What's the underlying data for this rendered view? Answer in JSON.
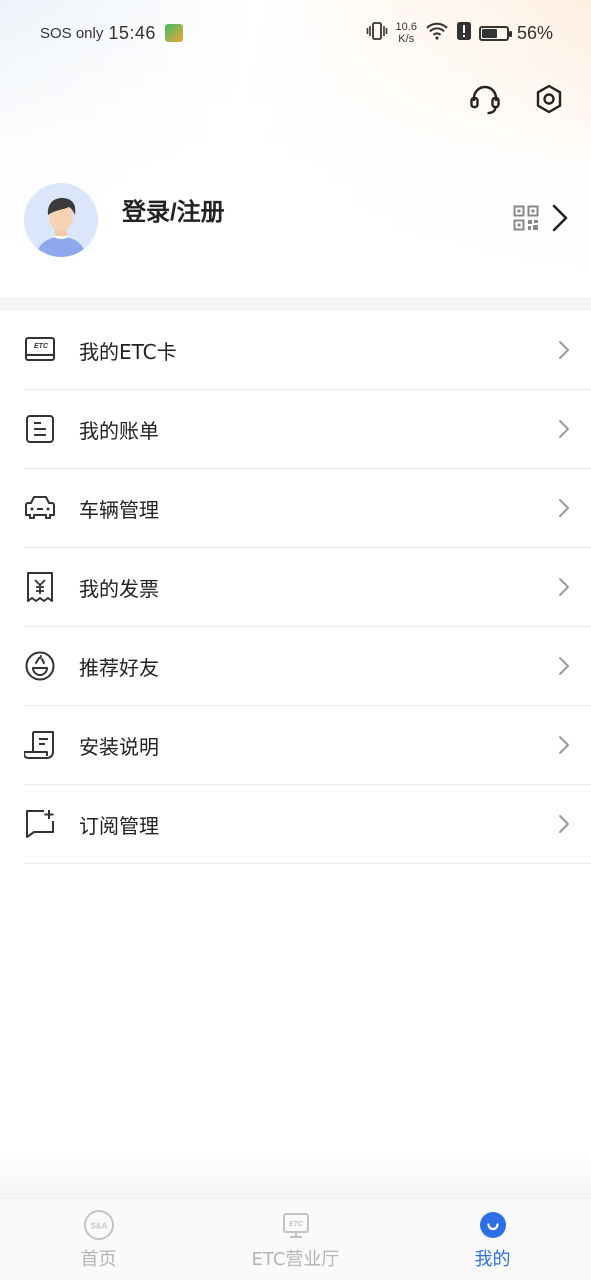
{
  "status_bar": {
    "carrier": "SOS only",
    "time": "15:46",
    "speed_value": "10.6",
    "speed_unit": "K/s",
    "battery": "56%"
  },
  "profile": {
    "login_label": "登录/注册"
  },
  "menu": {
    "items": [
      {
        "label": "我的ETC卡",
        "icon": "etc-card-icon"
      },
      {
        "label": "我的账单",
        "icon": "bill-icon"
      },
      {
        "label": "车辆管理",
        "icon": "car-icon"
      },
      {
        "label": "我的发票",
        "icon": "invoice-icon"
      },
      {
        "label": "推荐好友",
        "icon": "recommend-friend-icon"
      },
      {
        "label": "安装说明",
        "icon": "install-guide-icon"
      },
      {
        "label": "订阅管理",
        "icon": "subscription-icon"
      }
    ]
  },
  "bottom_nav": {
    "items": [
      {
        "label": "首页",
        "icon": "home-icon"
      },
      {
        "label": "ETC营业厅",
        "icon": "etc-hall-icon"
      },
      {
        "label": "我的",
        "icon": "mine-icon"
      }
    ],
    "active_index": 2
  },
  "colors": {
    "accent": "#2f6fe4",
    "inactive": "#b4b4b4",
    "text": "#222222"
  }
}
